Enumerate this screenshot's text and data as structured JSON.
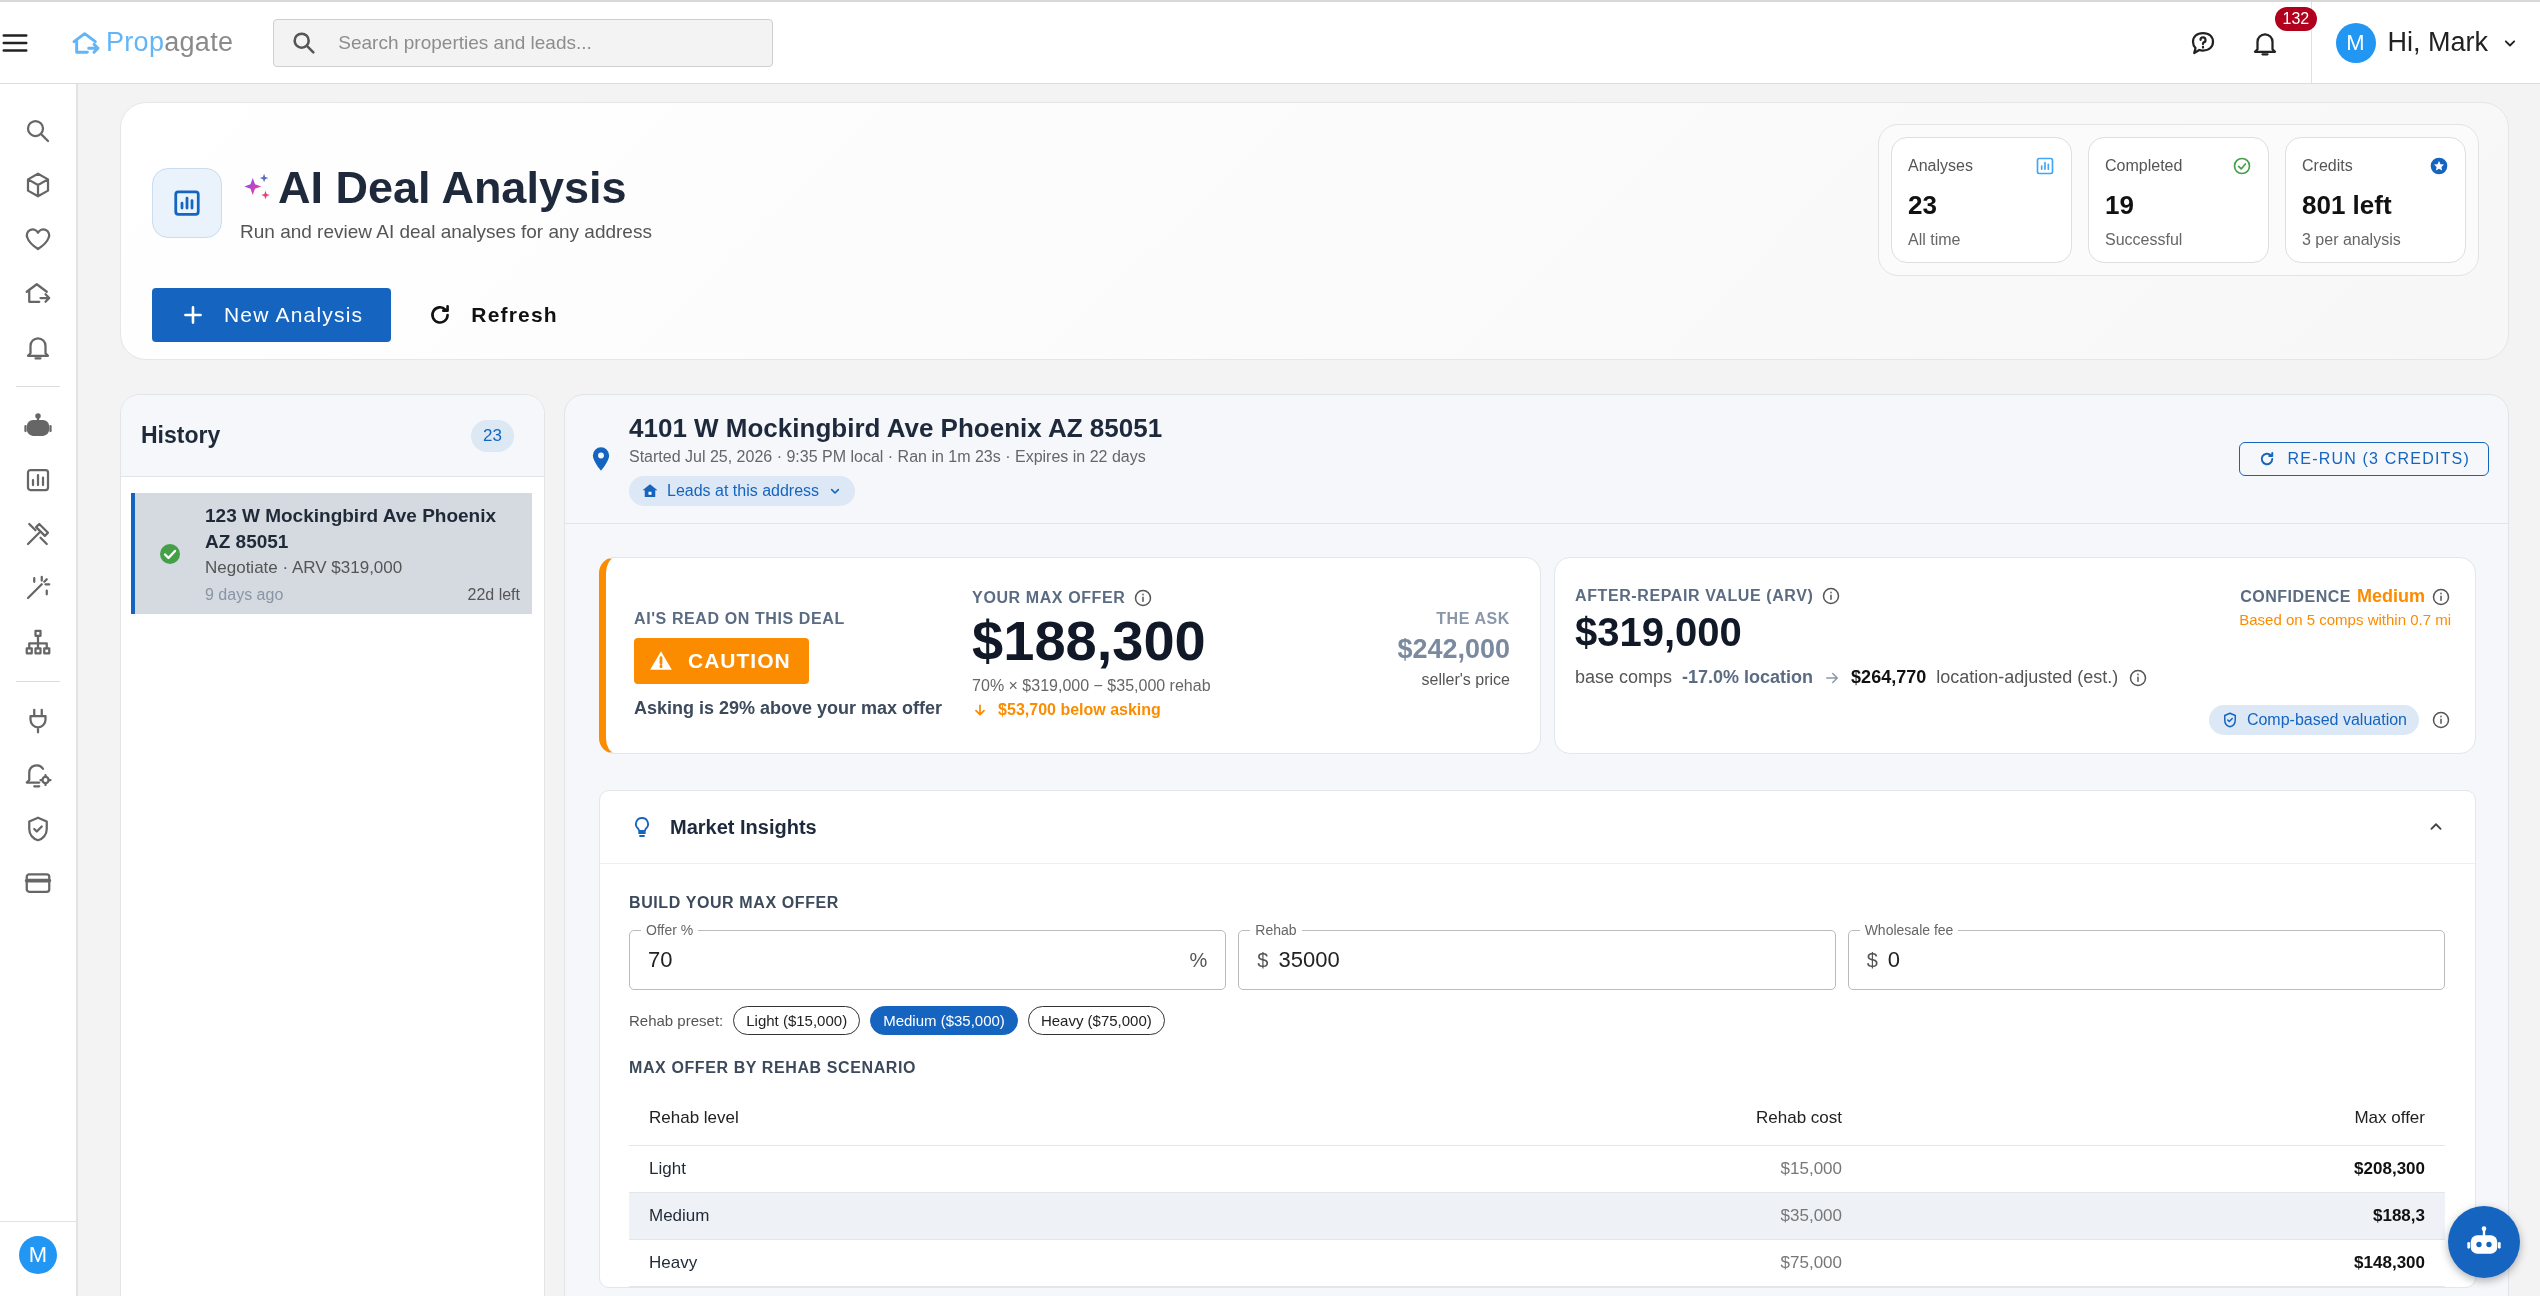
{
  "topbar": {
    "logo": [
      "Prop",
      "agate"
    ],
    "search": {
      "placeholder": "Search properties and leads..."
    },
    "notifications": "132",
    "user": {
      "initial": "M",
      "greeting": "Hi, Mark"
    }
  },
  "sidebar": {
    "user_initial": "M"
  },
  "header": {
    "title": "AI Deal Analysis",
    "subtitle": "Run and review AI deal analyses for any address",
    "buttons": [
      {
        "label": "New Analysis",
        "kind": "primary"
      },
      {
        "label": "Refresh",
        "kind": "text"
      }
    ],
    "stats": [
      {
        "label": "Analyses",
        "value": "23",
        "caption": "All time"
      },
      {
        "label": "Completed",
        "value": "19",
        "caption": "Successful"
      },
      {
        "label": "Credits",
        "value": "801 left",
        "caption": "3 per analysis"
      }
    ]
  },
  "history": {
    "title": "History",
    "count": "23",
    "items": [
      {
        "title": "123 W Mockingbird Ave Phoenix AZ 85051",
        "summary": "Negotiate · ARV $319,000",
        "age": "9 days ago",
        "remaining": "22d left",
        "completed": true,
        "selected": true
      }
    ]
  },
  "analysis": {
    "address": "4101 W Mockingbird Ave Phoenix AZ 85051",
    "meta": "Started Jul 25, 2026 · 9:35 PM local · Ran in 1m 23s · Expires in 22 days",
    "leads_button": "Leads at this address",
    "rerun_button": "RE-RUN (3 CREDITS)",
    "verdict": {
      "heading": "AI'S READ ON THIS DEAL",
      "label": "CAUTION",
      "note": "Asking is 29% above your max offer"
    },
    "max_offer": {
      "heading": "YOUR MAX OFFER",
      "value": "$188,300",
      "formula": "70% × $319,000 − $35,000 rehab",
      "delta": "$53,700 below asking"
    },
    "ask": {
      "heading": "THE ASK",
      "value": "$242,000",
      "caption": "seller's price"
    },
    "arv": {
      "heading": "AFTER-REPAIR VALUE (ARV)",
      "value": "$319,000",
      "base_label": "base comps",
      "adjustment": "-17.0% location",
      "adjusted_value": "$264,770",
      "adjusted_label": "location-adjusted (est.)",
      "confidence_label": "CONFIDENCE",
      "confidence": "Medium",
      "confidence_note": "Based on 5 comps within 0.7 mi",
      "valuation_badge": "Comp-based valuation"
    }
  },
  "insights": {
    "title": "Market Insights",
    "expanded": true,
    "build_heading": "BUILD YOUR MAX OFFER",
    "fields": [
      {
        "label": "Offer %",
        "value": "70",
        "suffix": "%"
      },
      {
        "label": "Rehab",
        "prefix": "$",
        "value": "35000"
      },
      {
        "label": "Wholesale fee",
        "prefix": "$",
        "value": "0"
      }
    ],
    "preset_label": "Rehab preset:",
    "presets": [
      {
        "label": "Light ($15,000)",
        "selected": false
      },
      {
        "label": "Medium ($35,000)",
        "selected": true
      },
      {
        "label": "Heavy ($75,000)",
        "selected": false
      }
    ],
    "scenario_heading": "MAX OFFER BY REHAB SCENARIO",
    "table": {
      "columns": [
        "Rehab level",
        "Rehab cost",
        "Max offer"
      ],
      "rows": [
        {
          "cells": [
            "Light",
            "$15,000",
            "$208,300"
          ],
          "selected": false
        },
        {
          "cells": [
            "Medium",
            "$35,000",
            "$188,3"
          ],
          "selected": true
        },
        {
          "cells": [
            "Heavy",
            "$75,000",
            "$148,300"
          ],
          "selected": false
        }
      ]
    }
  }
}
